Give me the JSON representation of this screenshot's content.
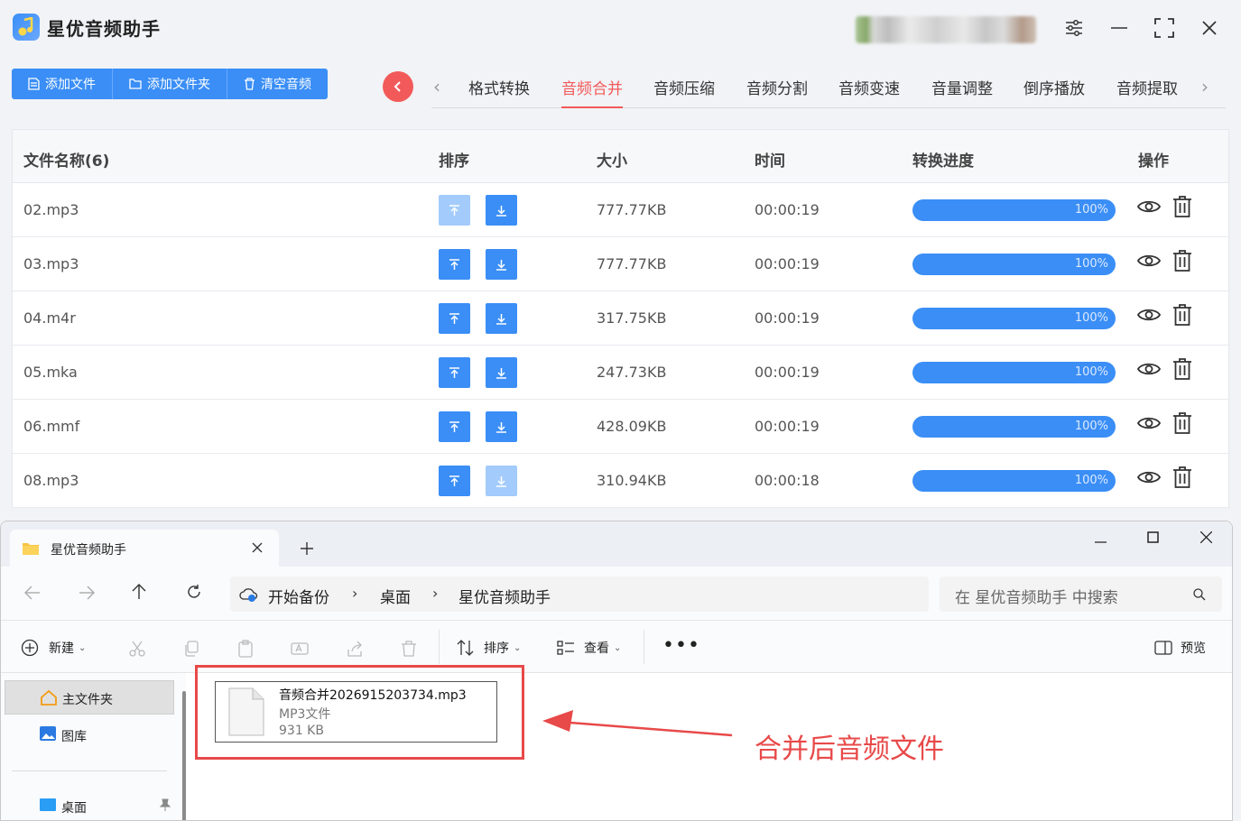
{
  "app": {
    "title": "星优音频助手",
    "toolbar": {
      "add_file": "添加文件",
      "add_folder": "添加文件夹",
      "clear": "清空音频"
    },
    "tabs": [
      "格式转换",
      "音频合并",
      "音频压缩",
      "音频分割",
      "音频变速",
      "音量调整",
      "倒序播放",
      "音频提取"
    ],
    "active_tab": "音频合并",
    "table": {
      "headers": {
        "name": "文件名称(6)",
        "order": "排序",
        "size": "大小",
        "time": "时间",
        "progress": "转换进度",
        "ops": "操作"
      },
      "rows": [
        {
          "name": "02.mp3",
          "size": "777.77KB",
          "time": "00:00:19",
          "progress": "100%",
          "up_enabled": false,
          "down_enabled": true
        },
        {
          "name": "03.mp3",
          "size": "777.77KB",
          "time": "00:00:19",
          "progress": "100%",
          "up_enabled": true,
          "down_enabled": true
        },
        {
          "name": "04.m4r",
          "size": "317.75KB",
          "time": "00:00:19",
          "progress": "100%",
          "up_enabled": true,
          "down_enabled": true
        },
        {
          "name": "05.mka",
          "size": "247.73KB",
          "time": "00:00:19",
          "progress": "100%",
          "up_enabled": true,
          "down_enabled": true
        },
        {
          "name": "06.mmf",
          "size": "428.09KB",
          "time": "00:00:19",
          "progress": "100%",
          "up_enabled": true,
          "down_enabled": true
        },
        {
          "name": "08.mp3",
          "size": "310.94KB",
          "time": "00:00:18",
          "progress": "100%",
          "up_enabled": true,
          "down_enabled": false
        }
      ]
    },
    "colors": {
      "accent": "#3a8ef6",
      "active_tab": "#f25a5a",
      "annotation": "#e84949"
    }
  },
  "explorer": {
    "tab_title": "星优音频助手",
    "breadcrumb": [
      "开始备份",
      "桌面",
      "星优音频助手"
    ],
    "search_placeholder": "在 星优音频助手 中搜索",
    "commands": {
      "new": "新建",
      "sort": "排序",
      "view": "查看",
      "preview": "预览"
    },
    "nav": [
      "主文件夹",
      "图库",
      "桌面"
    ],
    "file": {
      "name": "音频合并2026915203734.mp3",
      "type": "MP3文件",
      "size": "931 KB"
    },
    "annotation": "合并后音频文件"
  }
}
